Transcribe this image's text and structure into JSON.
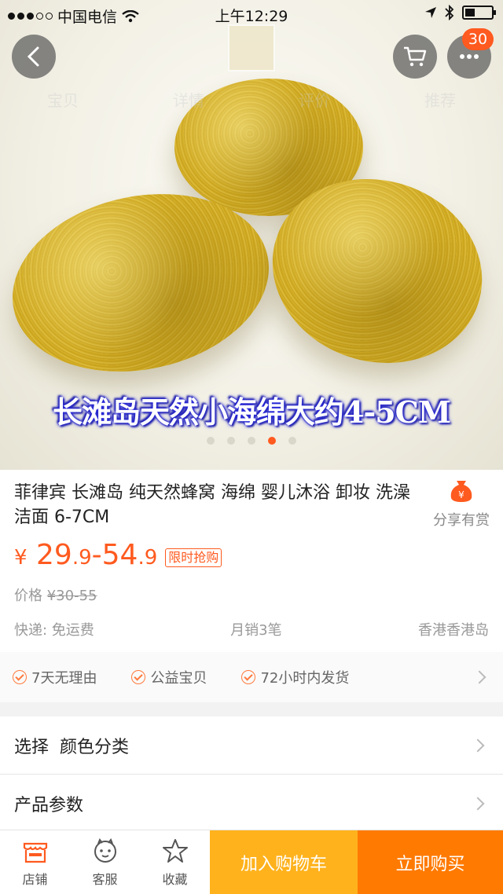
{
  "status_bar": {
    "carrier": "中国电信",
    "time": "上午12:29"
  },
  "nav": {
    "cart_badge": "30",
    "faded_tabs": [
      "宝贝",
      "详情",
      "评价",
      "推荐"
    ]
  },
  "hero": {
    "caption": "长滩岛天然小海绵大约4-5CM",
    "slide_count": 5,
    "active_slide": 4
  },
  "product": {
    "title": "菲律宾 长滩岛 纯天然蜂窝 海绵 婴儿沐浴 卸妆 洗澡 洁面 6-7CM",
    "share_label": "分享有赏",
    "price_currency": "¥",
    "price_low_int": "29",
    "price_low_dec": ".9",
    "price_sep": "-",
    "price_high_int": "54",
    "price_high_dec": ".9",
    "promo_tag": "限时抢购",
    "orig_label": "价格",
    "orig_price": "¥30-55",
    "shipping": "快递: 免运费",
    "monthly_sales": "月销3笔",
    "location": "香港香港岛"
  },
  "guarantees": [
    "7天无理由",
    "公益宝贝",
    "72小时内发货"
  ],
  "options": {
    "select_label": "选择  颜色分类",
    "params_label": "产品参数"
  },
  "bottom_bar": {
    "shop_label": "店铺",
    "service_label": "客服",
    "favorite_label": "收藏",
    "add_cart_label": "加入购物车",
    "buy_now_label": "立即购买"
  },
  "colors": {
    "accent": "#ff5a1f",
    "cart_button": "#ffb21c",
    "buy_button": "#ff7a00"
  },
  "icons": [
    "back-icon",
    "cart-icon",
    "more-icon",
    "wifi-icon",
    "location-arrow-icon",
    "bluetooth-icon",
    "battery-icon",
    "money-bag-icon",
    "check-circle-icon",
    "chevron-right-icon",
    "shop-icon",
    "service-icon",
    "star-icon"
  ]
}
